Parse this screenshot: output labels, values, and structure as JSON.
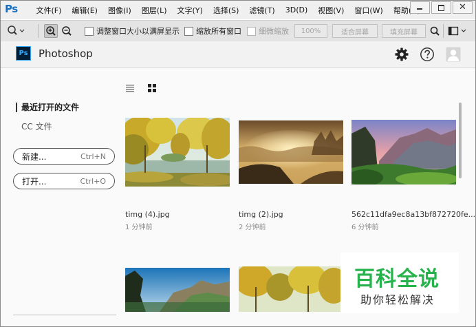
{
  "app": {
    "logo": "Ps",
    "menu": [
      "文件(F)",
      "编辑(E)",
      "图像(I)",
      "图层(L)",
      "文字(Y)",
      "选择(S)",
      "滤镜(T)",
      "3D(D)",
      "视图(V)",
      "窗口(W)",
      "帮助(H)"
    ],
    "window_close": "✕"
  },
  "options_bar": {
    "resize_windows_label": "调整窗口大小以满屏显示",
    "zoom_all_label": "缩放所有窗口",
    "scrubby_zoom_label": "细微缩放",
    "zoom_100_label": "100%",
    "fit_screen_label": "适合屏幕",
    "fill_screen_label": "填充屏幕"
  },
  "home": {
    "badge": "Ps",
    "title": "Photoshop"
  },
  "left_panel": {
    "recent_label": "最近打开的文件",
    "cc_files_label": "CC 文件",
    "new_label": "新建...",
    "new_shortcut": "Ctrl+N",
    "open_label": "打开...",
    "open_shortcut": "Ctrl+O"
  },
  "files": [
    {
      "name": "timg (4).jpg",
      "time": "1 分钟前"
    },
    {
      "name": "timg (2).jpg",
      "time": "2 分钟前"
    },
    {
      "name": "562c11dfa9ec8a13bf872720fe...",
      "time": "6 分钟前"
    },
    {
      "name": "",
      "time": ""
    },
    {
      "name": "",
      "time": ""
    }
  ],
  "watermark": {
    "main": "百科全说",
    "sub": "助你轻松解决"
  },
  "colors": {
    "accent": "#31a8ff",
    "watermark_green": "#26b34b"
  }
}
